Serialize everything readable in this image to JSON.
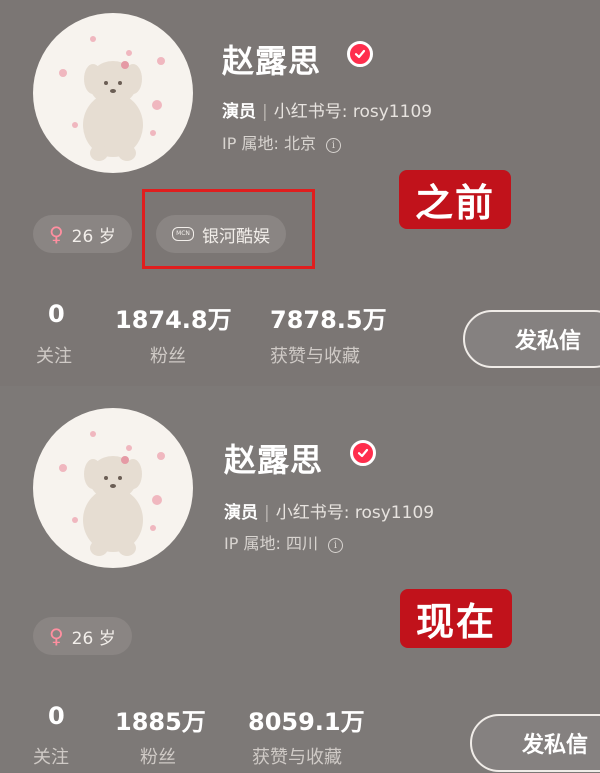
{
  "before": {
    "profile": {
      "name": "赵露思",
      "role": "演员",
      "id_label": "小红书号:",
      "id_value": "rosy1109",
      "ip_label": "IP 属地:",
      "ip_value": "北京",
      "age": "26 岁",
      "agency": "银河酷娱",
      "mcn_icon": "MCN"
    },
    "tag_label": "之前",
    "stats": {
      "following_count": "0",
      "following_label": "关注",
      "fans_count": "1874.8万",
      "fans_label": "粉丝",
      "likes_count": "7878.5万",
      "likes_label": "获赞与收藏"
    },
    "dm_button": "发私信"
  },
  "after": {
    "profile": {
      "name": "赵露思",
      "role": "演员",
      "id_label": "小红书号:",
      "id_value": "rosy1109",
      "ip_label": "IP 属地:",
      "ip_value": "四川",
      "age": "26 岁"
    },
    "tag_label": "现在",
    "stats": {
      "following_count": "0",
      "following_label": "关注",
      "fans_count": "1885万",
      "fans_label": "粉丝",
      "likes_count": "8059.1万",
      "likes_label": "获赞与收藏"
    },
    "dm_button": "发私信"
  },
  "colors": {
    "verified_badge": "#ff2e4d",
    "label_background": "#c1121b",
    "highlight_box": "#e01e1e",
    "female_symbol": "#ff8fa0"
  },
  "icons": {
    "verified": "verified-check-icon",
    "info": "info-icon",
    "gender": "female-icon",
    "agency": "mcn-icon"
  }
}
